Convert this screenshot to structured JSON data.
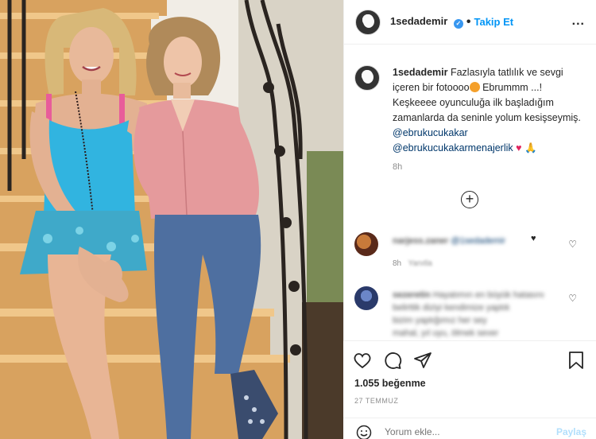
{
  "post": {
    "username": "1sedademir",
    "follow_label": "Takip Et",
    "more_label": "...",
    "caption_parts": {
      "text1": " Fazlasıyla tatlılık ve sevgi içeren bir fotoooo",
      "text2": " Ebrummm ...! Keşkeeee oyunculuğa ilk başladığım zamanlarda da seninle yolum kesişseymiş. ",
      "mention1": "@ebrukucukakar",
      "mention2": "@ebrukucukakarmenajerlik"
    },
    "time_ago": "8h",
    "likes": "1.055 beğenme",
    "date": "27 TEMMUZ"
  },
  "comments": [
    {
      "user": "narjess.zaner",
      "text": "@1sedademir",
      "time": "8h",
      "reply": "Yanıtla"
    },
    {
      "user": "sezeretin",
      "text": "Hayatımın en büyük hatasını belirttik diziyi kendimize yaptık",
      "line2": "bizim yaptığımız her sey",
      "line3": "mahal, yıl uyu, ölmek sever"
    }
  ],
  "comment_bar": {
    "placeholder": "Yorum ekle...",
    "post_label": "Paylaş"
  },
  "icons": [
    "verified-icon",
    "more-icon",
    "load-more-icon",
    "heart-icon",
    "comment-icon",
    "share-icon",
    "bookmark-icon",
    "smile-icon"
  ]
}
